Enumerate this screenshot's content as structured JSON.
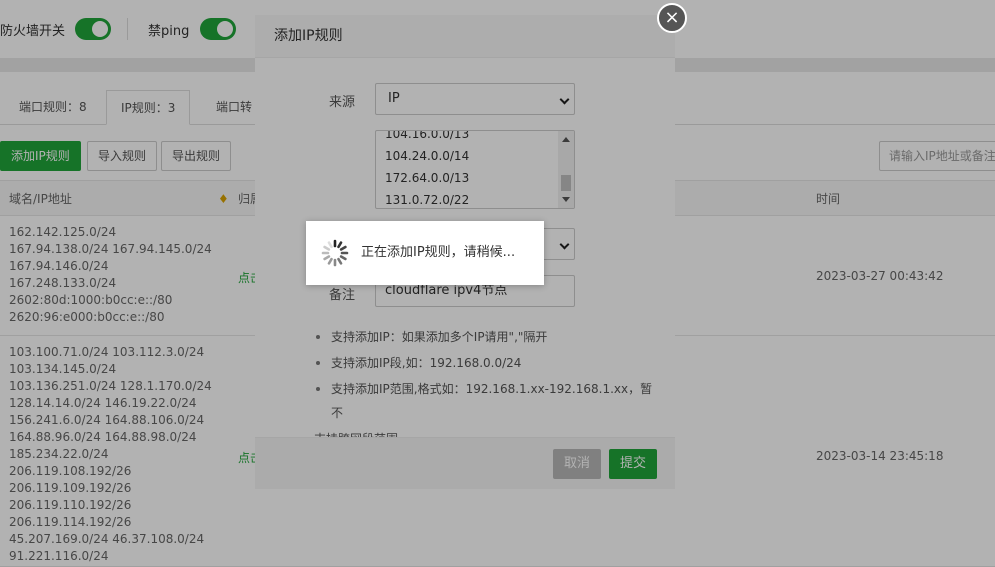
{
  "topbar": {
    "firewall_label": "防火墙开关",
    "ping_label": "禁ping"
  },
  "tabs": [
    {
      "label": "端口规则：8"
    },
    {
      "label": "IP规则：3"
    },
    {
      "label": "端口转"
    }
  ],
  "toolbar": {
    "add_label": "添加IP规则",
    "import_label": "导入规则",
    "export_label": "导出规则",
    "search_placeholder": "请输入IP地址或备注"
  },
  "table": {
    "columns": {
      "domain": "域名/IP地址",
      "belong": "归属",
      "time": "时间"
    },
    "rows": [
      {
        "ips": [
          "162.142.125.0/24",
          "167.94.138.0/24 167.94.145.0/24",
          "167.94.146.0/24",
          "167.248.133.0/24",
          "2602:80d:1000:b0cc:e::/80",
          "2620:96:e000:b0cc:e::/80"
        ],
        "click": "点击",
        "time": "2023-03-27 00:43:42"
      },
      {
        "ips": [
          "103.100.71.0/24 103.112.3.0/24",
          "103.134.145.0/24",
          "103.136.251.0/24 128.1.170.0/24",
          "128.14.14.0/24 146.19.22.0/24",
          "156.241.6.0/24 164.88.106.0/24",
          "164.88.96.0/24 164.88.98.0/24",
          "185.234.22.0/24",
          "206.119.108.192/26",
          "206.119.109.192/26",
          "206.119.110.192/26",
          "206.119.114.192/26",
          "45.207.169.0/24 46.37.108.0/24",
          "91.221.116.0/24"
        ],
        "click": "点击",
        "time": "2023-03-14 23:45:18"
      }
    ]
  },
  "modal": {
    "title": "添加IP规则",
    "source_label": "来源",
    "source_value": "IP",
    "ip_list": [
      "104.16.0.0/13",
      "104.24.0.0/14",
      "172.64.0.0/13",
      "131.0.72.0/22"
    ],
    "note_label": "备注",
    "note_value": "cloudflare  ipv4节点",
    "tips": [
      "支持添加IP：如果添加多个IP请用\",\"隔开",
      "支持添加IP段,如：192.168.0.0/24",
      "支持添加IP范围,格式如：192.168.1.xx-192.168.1.xx，暂不",
      "支持跨网段范围"
    ],
    "cancel_label": "取消",
    "submit_label": "提交",
    "close_symbol": "×"
  },
  "loading": {
    "text": "正在添加IP规则，请稍候..."
  },
  "colors": {
    "accent": "#20a53a",
    "cancel_disabled": "#a6a6a6"
  }
}
